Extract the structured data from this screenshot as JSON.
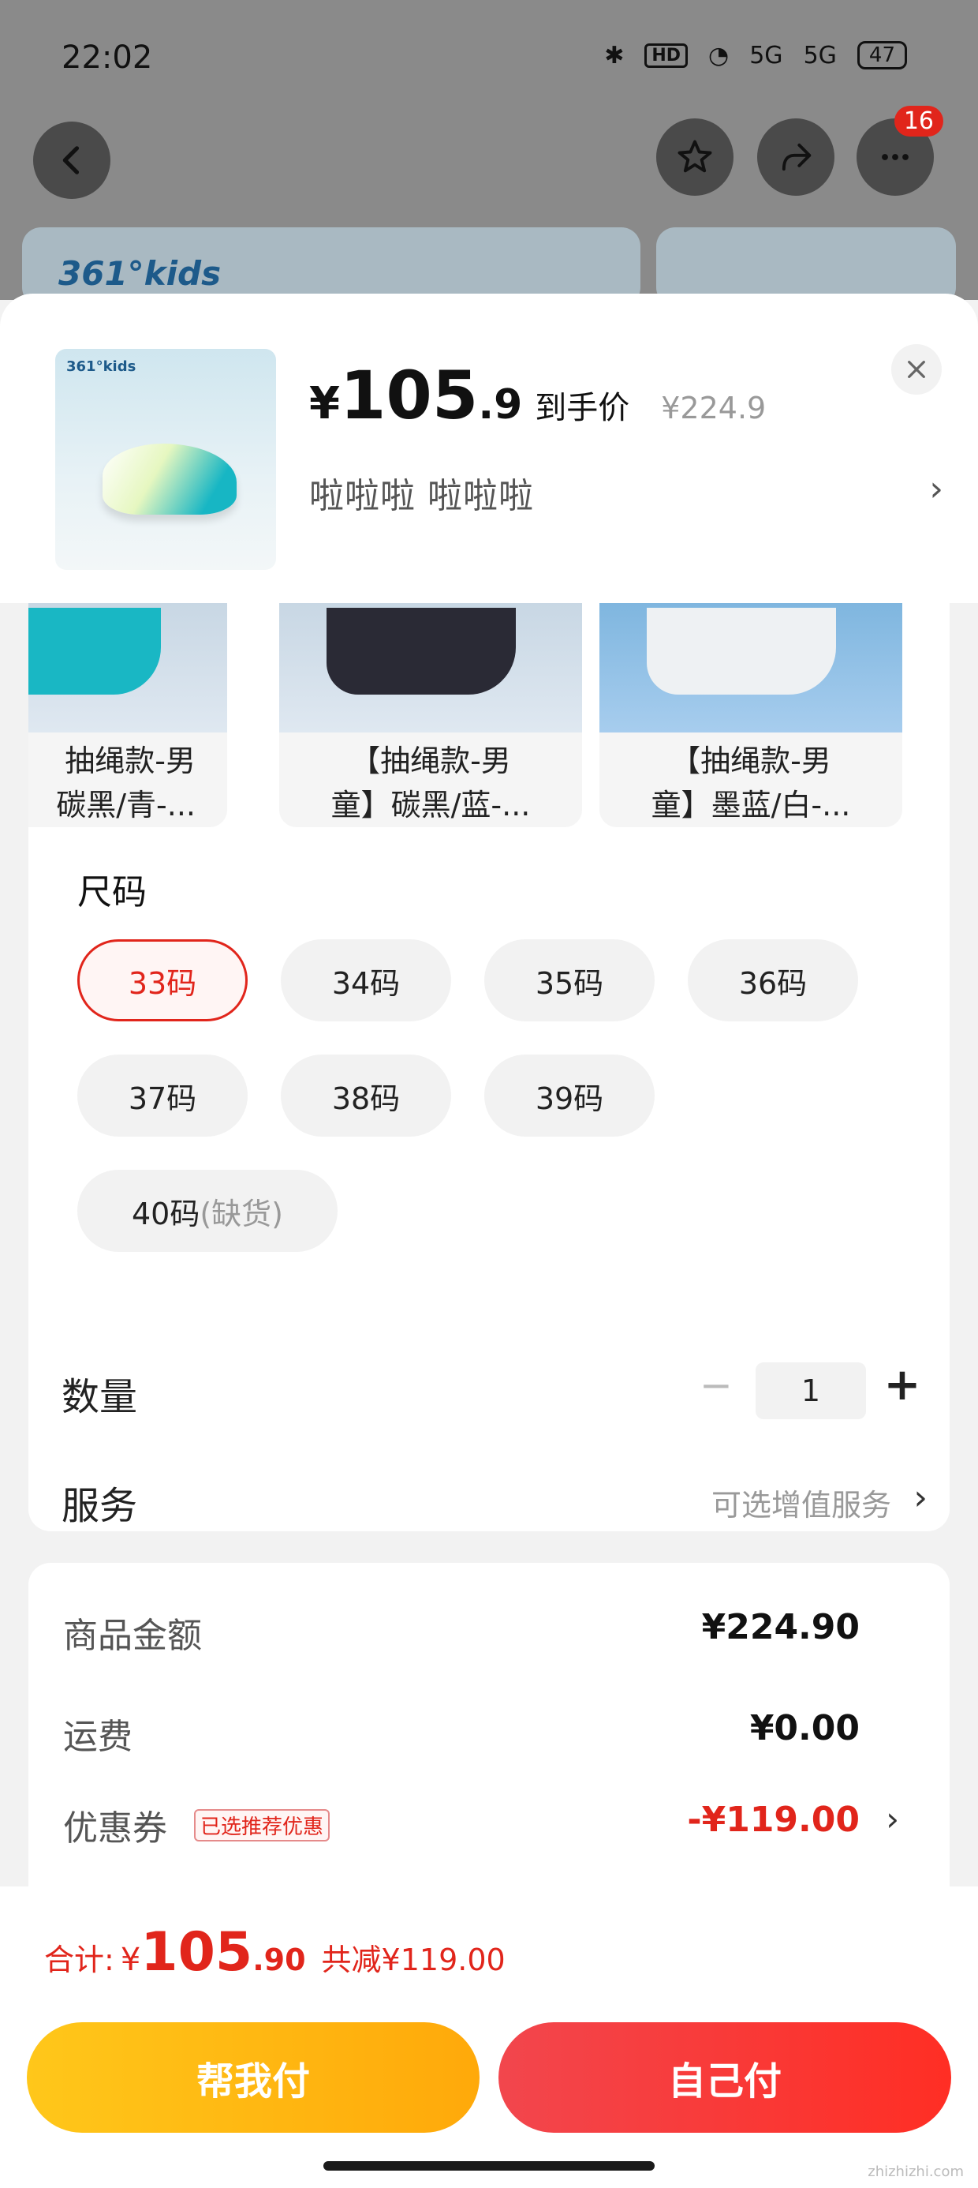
{
  "status_bar": {
    "time": "22:02",
    "hd": "HD",
    "network1": "5G",
    "network2": "5G",
    "battery": "47"
  },
  "top_nav": {
    "cart_badge": "16"
  },
  "backdrop": {
    "banner_brand": "361°kids"
  },
  "product": {
    "thumb_brand": "361°kids",
    "price_symbol": "¥",
    "price_int": "105",
    "price_dec": ".9",
    "price_tag": "到手价",
    "original_price": "¥224.9",
    "selected_spec": "啦啦啦  啦啦啦"
  },
  "styles": [
    {
      "line1": "抽绳款-男",
      "line2": "碳黑/青-...",
      "color": "#19b7c4"
    },
    {
      "line1": "【抽绳款-男",
      "line2": "童】碳黑/蓝-...",
      "color": "#2a2a35"
    },
    {
      "line1": "【抽绳款-男",
      "line2": "童】墨蓝/白-...",
      "color": "#eef1f3"
    }
  ],
  "size": {
    "title": "尺码",
    "options": [
      "33码",
      "34码",
      "35码",
      "36码",
      "37码",
      "38码",
      "39码",
      "40码"
    ],
    "selected": "33码",
    "out_of_stock_note": "(缺货)"
  },
  "quantity": {
    "label": "数量",
    "minus": "−",
    "value": "1",
    "plus": "+"
  },
  "service": {
    "label": "服务",
    "value": "可选增值服务",
    "chevron": "›"
  },
  "summary": {
    "goods_label": "商品金额",
    "goods_value": "¥224.90",
    "shipping_label": "运费",
    "shipping_value": "¥0.00",
    "coupon_label": "优惠券",
    "coupon_tag": "已选推荐优惠",
    "coupon_value": "-¥119.00"
  },
  "footer": {
    "total_label": "合计:",
    "total_symbol": "¥",
    "total_int": "105",
    "total_dec": ".90",
    "saved": "共减¥119.00",
    "help_pay": "帮我付",
    "self_pay": "自己付"
  },
  "watermark": "zhizhizhi.com",
  "colors": {
    "accent": "#e1251b",
    "help_button": "#ffb812",
    "self_button": "#f73a3a"
  }
}
